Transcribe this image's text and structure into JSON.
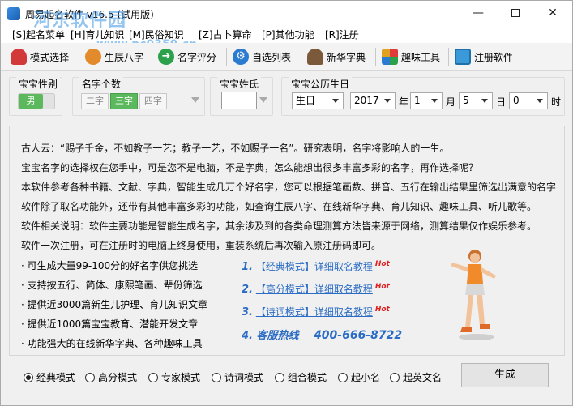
{
  "window": {
    "title": "周易起名软件 v16.5 (试用版)",
    "minimize": "—",
    "close": "✕"
  },
  "watermark": {
    "name": "河东软件园",
    "url": "www.pc0359.cn"
  },
  "menu": [
    "[S]起名菜单",
    "[H]育儿知识",
    "[M]民俗知识",
    "[Z]占卜算命",
    "[P]其他功能",
    "[R]注册"
  ],
  "toolbar": [
    {
      "label": "模式选择",
      "icon": "heart-icon",
      "color": "#d23a3a"
    },
    {
      "label": "生辰八字",
      "icon": "baby-icon",
      "color": "#e38b2c"
    },
    {
      "label": "名字评分",
      "icon": "arrow-right-icon",
      "color": "#2aa14a"
    },
    {
      "label": "自选列表",
      "icon": "gear-icon",
      "color": "#2b7bd0"
    },
    {
      "label": "新华字典",
      "icon": "scholar-icon",
      "color": "#7a5a3a"
    },
    {
      "label": "趣味工具",
      "icon": "blocks-icon",
      "color": "#e0a020"
    },
    {
      "label": "注册软件",
      "icon": "monitor-icon",
      "color": "#3a9ad9"
    }
  ],
  "options": {
    "gender": {
      "title": "宝宝性别",
      "value": "男"
    },
    "count": {
      "title": "名字个数",
      "items": [
        "二字",
        "三字",
        "四字"
      ],
      "selected": "三字"
    },
    "surname": {
      "title": "宝宝姓氏",
      "value": ""
    },
    "birth": {
      "title": "宝宝公历生日",
      "calendar": "生日",
      "year": "2017",
      "year_unit": "年",
      "month": "1",
      "month_unit": "月",
      "day": "5",
      "day_unit": "日",
      "hour": "0",
      "hour_unit": "时"
    }
  },
  "intro": {
    "lines": [
      "古人云：“赐子千金，不如教子一艺；教子一艺，不如赐子一名”。研究表明，名字将影响人的一生。",
      "宝宝名字的选择权在您手中，可是您不是电脑，不是字典，怎么能想出很多丰富多彩的名字，再作选择呢？",
      "本软件参考各种书籍、文献、字典，智能生成几万个好名字，您可以根据笔画数、拼音、五行在输出结果里筛选出满意的名字",
      "软件除了取名功能外，还带有其他丰富多彩的功能，如查询生辰八字、在线新华字典、育儿知识、趣味工具、听儿歌等。",
      "软件相关说明：软件主要功能是智能生成名字，其余涉及到的各类命理测算方法皆来源于网络，测算结果仅作娱乐参考。",
      "软件一次注册，可在注册时的电脑上终身使用，重装系统后再次输入原注册码即可。"
    ],
    "bullets": [
      "· 可生成大量99-100分的好名字供您挑选",
      "· 支持按五行、简体、康熙笔画、辈份筛选",
      "· 提供近3000篇新生儿护理、育儿知识文章",
      "· 提供近1000篇宝宝教育、潜能开发文章",
      "· 功能强大的在线新华字典、各种趣味工具"
    ],
    "guides": [
      {
        "num": "1.",
        "text": "【经典模式】详细取名教程",
        "hot": "Hot"
      },
      {
        "num": "2.",
        "text": "【高分模式】详细取名教程",
        "hot": "Hot"
      },
      {
        "num": "3.",
        "text": "【诗词模式】详细取名教程",
        "hot": "Hot"
      }
    ],
    "hotline": {
      "num": "4.",
      "label": "客服热线",
      "phone": "400-666-8722"
    }
  },
  "modes": {
    "selected": "经典模式",
    "items": [
      "经典模式",
      "高分模式",
      "专家模式",
      "诗词模式",
      "组合模式",
      "起小名",
      "起英文名"
    ]
  },
  "generate_button": "生成"
}
